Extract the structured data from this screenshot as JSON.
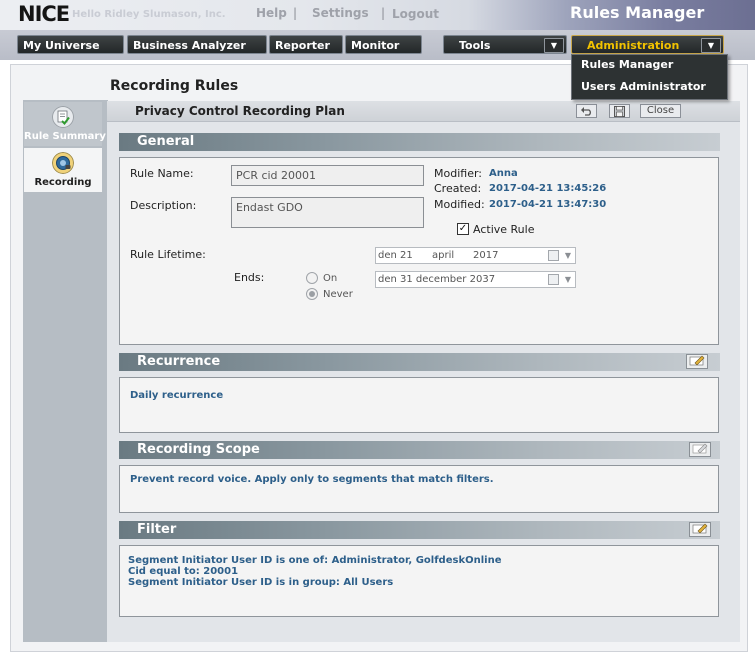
{
  "header": {
    "logo": "NICE",
    "logo_tail": "Hello Ridley Slumason, Inc.",
    "links": {
      "help": "Help",
      "settings": "Settings",
      "logout": "Logout"
    },
    "separator": "|",
    "app_title": "Rules Manager"
  },
  "nav": {
    "tabs": [
      "My Universe",
      "Business Analyzer",
      "Reporter",
      "Monitor"
    ],
    "tools": "Tools",
    "administration": "Administration",
    "admin_menu": [
      "Rules Manager",
      "Users Administrator"
    ]
  },
  "page": {
    "title": "Recording Rules",
    "plan_title": "Privacy Control Recording Plan",
    "close_label": "Close",
    "left_tabs": [
      {
        "label": "Rule Summary",
        "icon": "rule-summary-icon"
      },
      {
        "label": "Recording",
        "icon": "recording-icon"
      }
    ]
  },
  "general": {
    "section_title": "General",
    "rule_name_label": "Rule Name:",
    "rule_name_value": "PCR cid 20001",
    "description_label": "Description:",
    "description_value": "Endast GDO",
    "modifier_label": "Modifier:",
    "modifier_value": "Anna",
    "created_label": "Created:",
    "created_value": "2017-04-21 13:45:26",
    "modified_label": "Modified:",
    "modified_value": "2017-04-21 13:47:30",
    "active_rule_label": "Active Rule",
    "active_rule_checked": true,
    "lifetime_label": "Rule Lifetime:",
    "start_date": {
      "day": "den 21",
      "month": "april",
      "year": "2017"
    },
    "ends_label": "Ends:",
    "end_date": "den 31 december 2037",
    "end_on_label": "On",
    "end_never_label": "Never",
    "end_selected": "Never"
  },
  "recurrence": {
    "section_title": "Recurrence",
    "text": "Daily recurrence"
  },
  "scope": {
    "section_title": "Recording Scope",
    "text": "Prevent record voice. Apply only to segments that match filters."
  },
  "filter": {
    "section_title": "Filter",
    "lines": [
      "Segment Initiator User ID is one of:  Administrator, GolfdeskOnline",
      "Cid equal to: 20001",
      "Segment Initiator User ID is in group:  All Users"
    ]
  },
  "colors": {
    "accent_admin": "#f2c200",
    "link_blue": "#2d5f8a",
    "nav_dark": "#2a2d2e"
  }
}
